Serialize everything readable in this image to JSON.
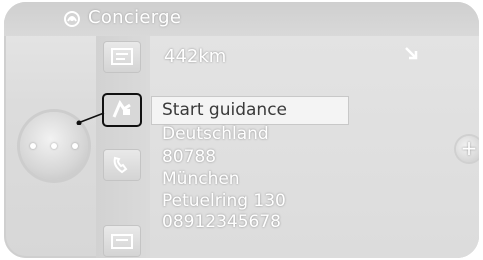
{
  "title": "Concierge",
  "icons": {
    "title": "concierge-icon",
    "arrow": "arrow-down-right-icon",
    "buttons": [
      "contact-card-icon",
      "navigation-flag-icon",
      "phone-icon",
      "message-icon"
    ]
  },
  "info": {
    "distance": "442km"
  },
  "menu": {
    "start_guidance": "Start guidance",
    "country": "Deutschland",
    "postcode": "80788",
    "city": "München",
    "street": "Petuelring 130",
    "phone": "08912345678"
  },
  "controls": {
    "plus": "+"
  }
}
